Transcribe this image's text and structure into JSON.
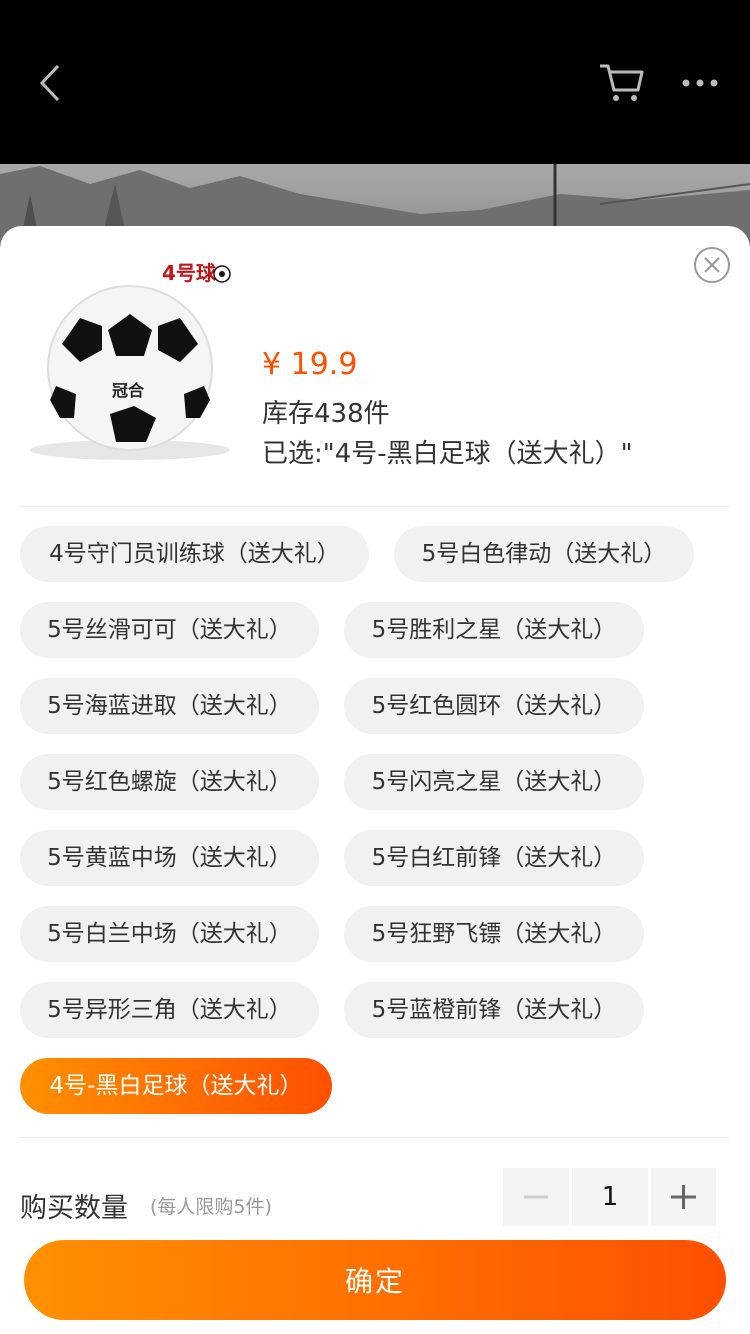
{
  "header": {
    "back_icon": "chevron-left-icon",
    "cart_icon": "cart-icon",
    "more_icon": "more-dots-icon"
  },
  "product": {
    "image_badge": "4号球",
    "ball_logo": "冠合",
    "price": "¥ 19.9",
    "stock": "库存438件",
    "selected": "已选:\"4号-黑白足球（送大礼）\""
  },
  "options": [
    {
      "label": "4号守门员训练球（送大礼）",
      "active": false
    },
    {
      "label": "5号白色律动（送大礼）",
      "active": false
    },
    {
      "label": "5号丝滑可可（送大礼）",
      "active": false
    },
    {
      "label": "5号胜利之星（送大礼）",
      "active": false
    },
    {
      "label": "5号海蓝进取（送大礼）",
      "active": false
    },
    {
      "label": "5号红色圆环（送大礼）",
      "active": false
    },
    {
      "label": "5号红色螺旋（送大礼）",
      "active": false
    },
    {
      "label": "5号闪亮之星（送大礼）",
      "active": false
    },
    {
      "label": "5号黄蓝中场（送大礼）",
      "active": false
    },
    {
      "label": "5号白红前锋（送大礼）",
      "active": false
    },
    {
      "label": "5号白兰中场（送大礼）",
      "active": false
    },
    {
      "label": "5号狂野飞镖（送大礼）",
      "active": false
    },
    {
      "label": "5号异形三角（送大礼）",
      "active": false
    },
    {
      "label": "5号蓝橙前锋（送大礼）",
      "active": false
    },
    {
      "label": "4号-黑白足球（送大礼）",
      "active": true
    }
  ],
  "quantity": {
    "label": "购买数量",
    "hint": "(每人限购5件)",
    "value": "1"
  },
  "confirm_label": "确定",
  "colors": {
    "accent": "#ff5000",
    "accent_light": "#ff9000"
  }
}
